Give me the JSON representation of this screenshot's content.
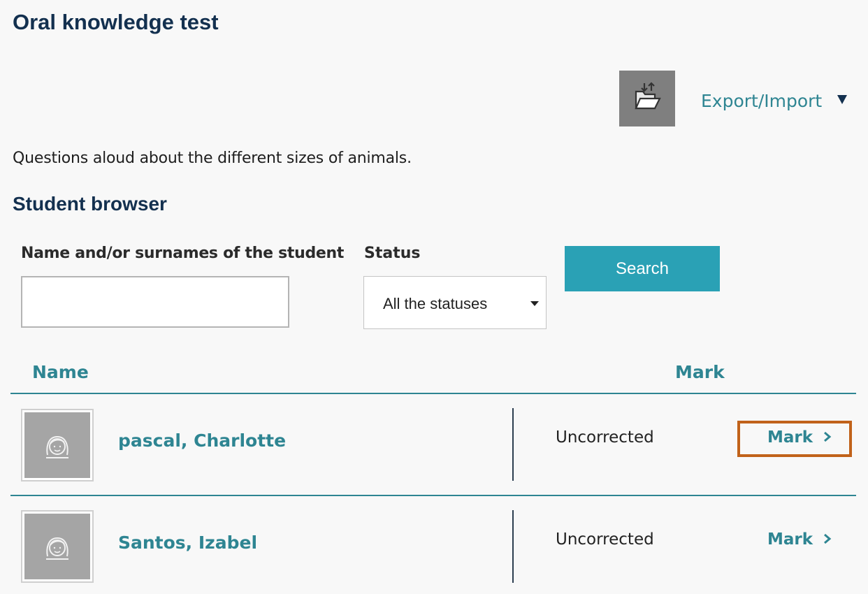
{
  "page": {
    "title": "Oral knowledge test",
    "export_import_label": "Export/Import",
    "description": "Questions aloud about the different sizes of animals."
  },
  "browser": {
    "title": "Student browser",
    "name_label": "Name and/or surnames of the student",
    "name_value": "",
    "status_label": "Status",
    "status_selected": "All the statuses",
    "search_label": "Search"
  },
  "table": {
    "headers": {
      "name": "Name",
      "mark": "Mark"
    },
    "rows": [
      {
        "name": "pascal, Charlotte",
        "status": "Uncorrected",
        "action": "Mark"
      },
      {
        "name": "Santos, Izabel",
        "status": "Uncorrected",
        "action": "Mark"
      }
    ]
  },
  "icons": {
    "export": "folder-export-import-icon",
    "avatar": "girl-avatar-icon",
    "chevron": "chevron-right-icon"
  },
  "colors": {
    "title": "#13304f",
    "accent": "#2e8592",
    "button": "#2aa1b5",
    "highlight": "#c1621a"
  }
}
